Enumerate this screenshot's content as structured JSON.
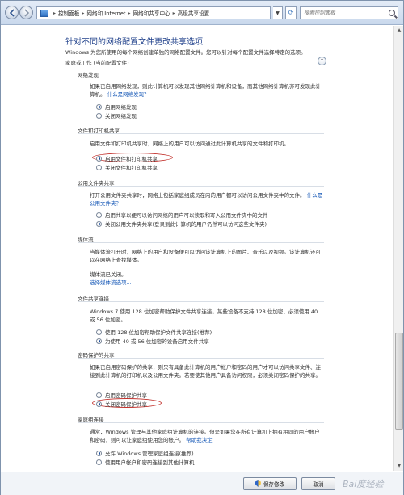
{
  "addressbar": {
    "breadcrumbs": [
      "控制面板",
      "网络和 Internet",
      "网络和共享中心",
      "高级共享设置"
    ],
    "search_placeholder": "搜索控制面板"
  },
  "page": {
    "title": "针对不同的网络配置文件更改共享选项",
    "subtitle": "Windows 为您所使用的每个网络创建单独的网络配置文件。您可以针对每个配置文件选择特定的选项。",
    "profile_heading": "家庭或工作 (当前配置文件)"
  },
  "sections": [
    {
      "heading": "网络发现",
      "desc": "如果已启用网络发现，则此计算机可以发现其他网络计算机和设备，而其他网络计算机亦可发现此计算机。",
      "link": "什么是网络发现？",
      "options": [
        {
          "label": "启用网络发现",
          "selected": true
        },
        {
          "label": "关闭网络发现",
          "selected": false
        }
      ]
    },
    {
      "heading": "文件和打印机共享",
      "desc": "启用文件和打印机共享时，网络上的用户可以访问通过此计算机共享的文件和打印机。",
      "link": "",
      "options": [
        {
          "label": "启用文件和打印机共享",
          "selected": true
        },
        {
          "label": "关闭文件和打印机共享",
          "selected": false
        }
      ]
    },
    {
      "heading": "公用文件夹共享",
      "desc": "打开公用文件夹共享时，网络上包括家庭组成员在内的用户都可以访问公用文件夹中的文件。",
      "link": "什么是公用文件夹？",
      "options": [
        {
          "label": "启用共享以便可以访问网络的用户可以读取和写入公用文件夹中的文件",
          "selected": false
        },
        {
          "label": "关闭公用文件夹共享(登录到此计算机的用户仍然可以访问这些文件夹)",
          "selected": true
        }
      ]
    },
    {
      "heading": "媒体流",
      "desc": "当媒体流打开时，网络上的用户和设备便可以访问该计算机上的图片、音乐以及视频。该计算机还可以在网络上查找媒体。",
      "status": "媒体流已关闭。",
      "link": "选择媒体流选项...",
      "options": []
    },
    {
      "heading": "文件共享连接",
      "desc": "Windows 7 使用 128 位加密帮助保护文件共享连接。某些设备不支持 128 位加密，必须使用 40 或 56 位加密。",
      "link": "",
      "options": [
        {
          "label": "使用 128 位加密帮助保护文件共享连接(推荐)",
          "selected": false
        },
        {
          "label": "为使用 40 或 56 位加密的设备启用文件共享",
          "selected": true
        }
      ]
    },
    {
      "heading": "密码保护的共享",
      "desc": "如果已启用密码保护的共享，则只有具备此计算机的用户帐户和密码的用户才可以访问共享文件、连接到此计算机的打印机以及公用文件夹。若要使其他用户具备访问权限，必须关闭密码保护的共享。",
      "link": "",
      "options": [
        {
          "label": "启用密码保护共享",
          "selected": false
        },
        {
          "label": "关闭密码保护共享",
          "selected": true
        }
      ]
    },
    {
      "heading": "家庭组连接",
      "desc": "通常，Windows 管理与其他家庭组计算机的连接。但是如果您在所有计算机上拥有相同的用户帐户和密码，则可以让家庭组使用您的帐户。",
      "link": "帮助我决定",
      "options": [
        {
          "label": "允许 Windows 管理家庭组连接(推荐)",
          "selected": true
        },
        {
          "label": "使用用户帐户和密码连接到其他计算机",
          "selected": false
        }
      ]
    }
  ],
  "footer": {
    "save_label": "保存修改",
    "cancel_label": "取消"
  },
  "watermark": "Bai度经验",
  "colors": {
    "title": "#1e3f8a",
    "link": "#1a5bb8",
    "highlight": "#c2312c"
  }
}
